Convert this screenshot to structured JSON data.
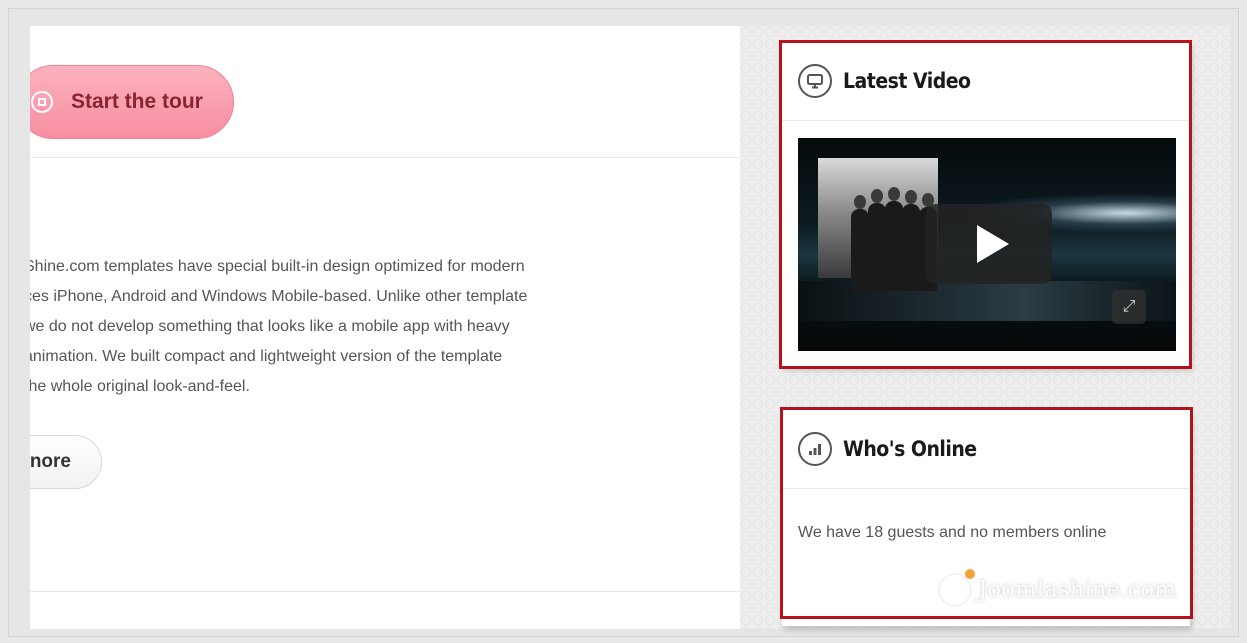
{
  "main": {
    "tour_button_label": "Start the tour",
    "description_lines": [
      "Shine.com templates have special built-in design optimized for modern",
      "ces iPhone, Android and Windows Mobile-based. Unlike other template",
      "we do not develop something that looks like a mobile app with heavy",
      "animation. We built compact and lightweight version of the template",
      "the whole original look-and-feel."
    ],
    "more_button_label": "nore"
  },
  "sidebar": {
    "latest_video": {
      "title": "Latest Video",
      "icon": "monitor-icon"
    },
    "whos_online": {
      "title": "Who's Online",
      "icon": "bar-chart-icon",
      "text": "We have 18 guests and no members online"
    }
  },
  "watermark": {
    "text": "Joomlashine.com"
  },
  "colors": {
    "highlight_border": "#b5121b",
    "tour_button": "#f78ea1",
    "tour_text": "#8a2232"
  }
}
